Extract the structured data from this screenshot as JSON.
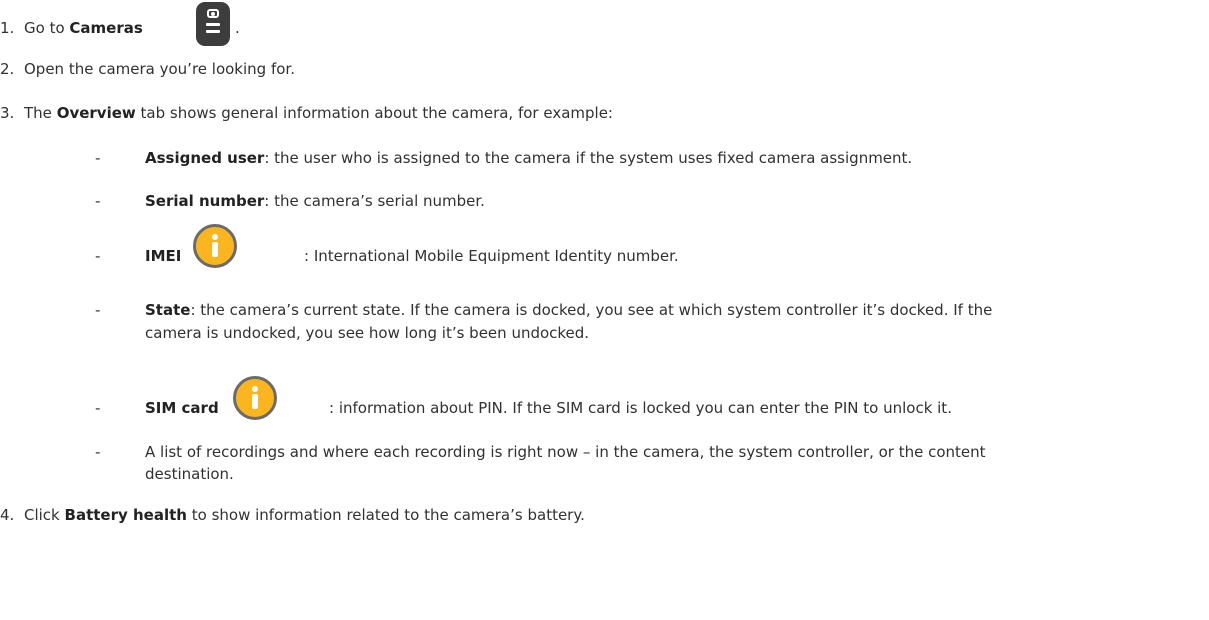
{
  "steps": [
    {
      "number": "1.",
      "pre": "Go to",
      "bold": "Cameras",
      "icon": "camera-icon",
      "post": "."
    },
    {
      "number": "2.",
      "text": "Open the camera you’re looking for."
    },
    {
      "number": "3.",
      "pre": "The",
      "bold": "Overview",
      "post": "tab shows general information about the camera, for example:",
      "bullets": [
        {
          "term": "Assigned user",
          "desc": ": the user who is assigned to the camera if the system uses fixed camera assignment."
        },
        {
          "term": "Serial number",
          "desc": ": the camera’s serial number."
        },
        {
          "term": "IMEI",
          "icon": "info-icon",
          "desc": ": International Mobile Equipment Identity number."
        },
        {
          "term": "State",
          "desc_line1": ": the camera’s current state. If the camera is docked, you see at which system controller it’s docked. If the",
          "desc_line2": "camera is undocked, you see how long it’s been undocked."
        },
        {
          "term": "SIM card",
          "icon": "info-icon",
          "desc": ": information about PIN. If the SIM card is locked you can enter the PIN to unlock it."
        },
        {
          "desc_line1": "A list of recordings and where each recording is right now – in the camera, the system controller, or the content",
          "desc_line2": "destination."
        }
      ]
    },
    {
      "number": "4.",
      "pre": "Click",
      "bold": "Battery health",
      "post": "to show information related to the camera’s battery."
    }
  ],
  "dash": "-",
  "colors": {
    "text": "#313131",
    "info_icon_fill": "#fbb51f",
    "camera_icon_fill": "#3d3d3d"
  }
}
